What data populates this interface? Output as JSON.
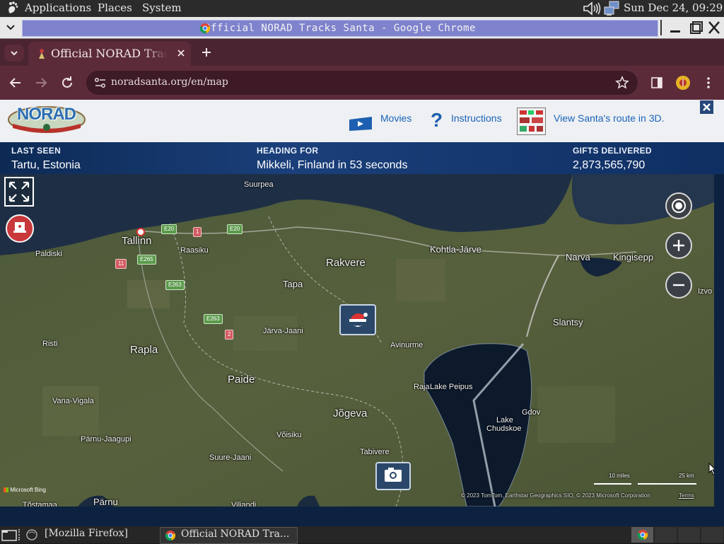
{
  "gnome_panel": {
    "menus": [
      "Applications",
      "Places",
      "System"
    ],
    "clock": "Sun Dec 24, 09:29"
  },
  "window": {
    "title": "Official NORAD Tracks Santa - Google Chrome"
  },
  "browser": {
    "tab_title": "Official NORAD Track",
    "url": "noradsanta.org/en/map"
  },
  "site": {
    "logo_text": "NORAD",
    "nav": {
      "movies": "Movies",
      "instructions": "Instructions",
      "route_3d": "View Santa's route in 3D."
    },
    "status": {
      "last_seen_label": "LAST SEEN",
      "last_seen_value": "Tartu, Estonia",
      "heading_label": "HEADING FOR",
      "heading_value": "Mikkeli, Finland in 53 seconds",
      "gifts_label": "GIFTS DELIVERED",
      "gifts_value": "2,873,565,790"
    }
  },
  "map": {
    "places": {
      "suurpea": "Suurpea",
      "tallinn": "Tallinn",
      "paldiski": "Paldiski",
      "raasiku": "Raasiku",
      "rakvere": "Rakvere",
      "kohtla": "Kohtla-Järve",
      "narva": "Narva",
      "kingisepp": "Kingisepp",
      "izvo": "Izvo",
      "tapa": "Tapa",
      "slantsy": "Slantsy",
      "risti": "Risti",
      "rapla": "Rapla",
      "jarva": "Järva-Jaani",
      "avinurme": "Avinurme",
      "paide": "Paide",
      "raja": "Raja",
      "peipus": "Lake Peipus",
      "vana": "Vana-Vigala",
      "jogeva": "Jõgeva",
      "lake_chudskoe_1": "Lake",
      "lake_chudskoe_2": "Chudskoe",
      "gdov": "Gdov",
      "parnu_jaagupi": "Pärnu-Jaagupi",
      "voisiku": "Võisiku",
      "tabivere": "Tabivere",
      "suure": "Suure-Jaani",
      "parnu": "Pärnu",
      "tostamaa": "Tõstamaa",
      "viljandi": "Viljandi"
    },
    "roads": [
      "E20",
      "1",
      "E20",
      "E265",
      "11",
      "E263",
      "E263",
      "2"
    ],
    "attribution": "© 2023 TomTom, Earthstar Geographics SIO, © 2023 Microsoft Corporation",
    "terms": "Terms",
    "provider": "Microsoft Bing",
    "scale_miles": "10 miles",
    "scale_km": "25 km"
  },
  "taskbar": {
    "items": [
      "[Mozilla Firefox]",
      "Official NORAD Tra..."
    ]
  },
  "colors": {
    "panel": "#2b2b2b",
    "tab_bar": "#4a2430",
    "toolbar": "#5c2b3a",
    "title_strip": "#7f82cc",
    "status_bar": "#123566",
    "link": "#1b63b8"
  }
}
